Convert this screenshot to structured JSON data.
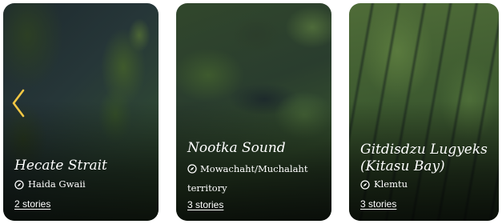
{
  "carousel": {
    "prev_icon": "chevron-left-icon",
    "accent_color": "#f2c744",
    "cards": [
      {
        "title": "Hecate Strait",
        "location": "Haida Gwaii",
        "stories": "2 stories",
        "location_icon": "compass-icon"
      },
      {
        "title": "Nootka Sound",
        "location": "Mowachaht/Muchalaht territory",
        "stories": "3 stories",
        "location_icon": "compass-icon"
      },
      {
        "title_line1": "Gitdisdzu Lugyeks",
        "title_line2": "(Kitasu Bay)",
        "location": "Klemtu",
        "stories": "3 stories",
        "location_icon": "compass-icon"
      }
    ]
  }
}
